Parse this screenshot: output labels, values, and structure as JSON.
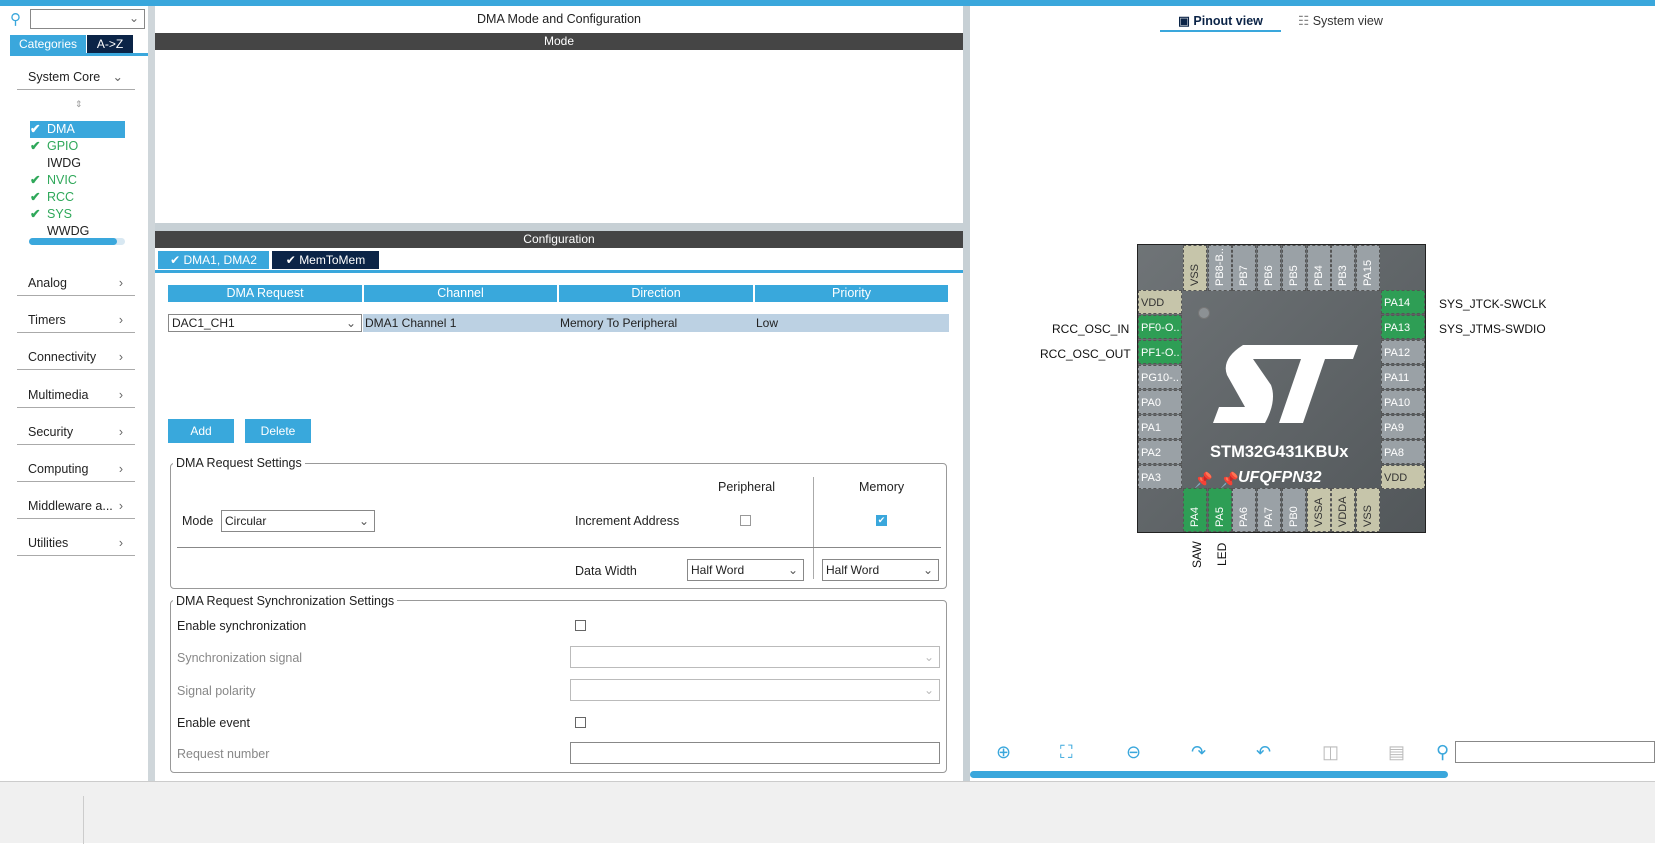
{
  "left": {
    "search_value": "",
    "tabs": [
      "Categories",
      "A->Z"
    ],
    "categories": [
      {
        "label": "System Core",
        "open": true
      },
      {
        "label": "Analog"
      },
      {
        "label": "Timers"
      },
      {
        "label": "Connectivity"
      },
      {
        "label": "Multimedia"
      },
      {
        "label": "Security"
      },
      {
        "label": "Computing"
      },
      {
        "label": "Middleware a..."
      },
      {
        "label": "Utilities"
      }
    ],
    "peripherals": [
      {
        "label": "DMA",
        "checked": true,
        "selected": true
      },
      {
        "label": "GPIO",
        "checked": true
      },
      {
        "label": "IWDG",
        "checked": false
      },
      {
        "label": "NVIC",
        "checked": true
      },
      {
        "label": "RCC",
        "checked": true
      },
      {
        "label": "SYS",
        "checked": true
      },
      {
        "label": "WWDG",
        "checked": false
      }
    ]
  },
  "middle": {
    "title": "DMA Mode and Configuration",
    "mode_header": "Mode",
    "config_header": "Configuration",
    "tabs": [
      "DMA1, DMA2",
      "MemToMem"
    ],
    "table": {
      "headers": [
        "DMA Request",
        "Channel",
        "Direction",
        "Priority"
      ],
      "rows": [
        [
          "DAC1_CH1",
          "DMA1 Channel 1",
          "Memory To Peripheral",
          "Low"
        ]
      ]
    },
    "add": "Add",
    "delete": "Delete",
    "req_settings": {
      "title": "DMA Request Settings",
      "peripheral": "Peripheral",
      "memory": "Memory",
      "mode_label": "Mode",
      "mode_value": "Circular",
      "increment_label": "Increment Address",
      "periph_increment": false,
      "mem_increment": true,
      "data_width_label": "Data Width",
      "periph_width": "Half Word",
      "mem_width": "Half Word"
    },
    "sync_settings": {
      "title": "DMA Request Synchronization Settings",
      "enable_sync": "Enable synchronization",
      "sync_signal": "Synchronization signal",
      "signal_polarity": "Signal polarity",
      "enable_event": "Enable event",
      "request_number": "Request number"
    }
  },
  "right": {
    "tabs": [
      "Pinout view",
      "System view"
    ],
    "chip": {
      "name": "STM32G431KBUx",
      "package": "UFQFPN32",
      "top": [
        [
          "VSS",
          "p"
        ],
        [
          "PB8-B..",
          "g"
        ],
        [
          "PB7",
          "g"
        ],
        [
          "PB6",
          "g"
        ],
        [
          "PB5",
          "g"
        ],
        [
          "PB4",
          "g"
        ],
        [
          "PB3",
          "g"
        ],
        [
          "PA15",
          "g"
        ]
      ],
      "left": [
        [
          "VDD",
          "p"
        ],
        [
          "PF0-O..",
          "a"
        ],
        [
          "PF1-O..",
          "a"
        ],
        [
          "PG10-..",
          "g"
        ],
        [
          "PA0",
          "g"
        ],
        [
          "PA1",
          "g"
        ],
        [
          "PA2",
          "g"
        ],
        [
          "PA3",
          "g"
        ]
      ],
      "right": [
        [
          "PA14",
          "a"
        ],
        [
          "PA13",
          "a"
        ],
        [
          "PA12",
          "g"
        ],
        [
          "PA11",
          "g"
        ],
        [
          "PA10",
          "g"
        ],
        [
          "PA9",
          "g"
        ],
        [
          "PA8",
          "g"
        ],
        [
          "VDD",
          "p"
        ]
      ],
      "bottom": [
        [
          "PA4",
          "a"
        ],
        [
          "PA5",
          "a"
        ],
        [
          "PA6",
          "g"
        ],
        [
          "PA7",
          "g"
        ],
        [
          "PB0",
          "g"
        ],
        [
          "VSSA",
          "p"
        ],
        [
          "VDDA",
          "p"
        ],
        [
          "VSS",
          "p"
        ]
      ]
    },
    "signals": {
      "rcc_in": "RCC_OSC_IN",
      "rcc_out": "RCC_OSC_OUT",
      "swclk": "SYS_JTCK-SWCLK",
      "swdio": "SYS_JTMS-SWDIO",
      "saw": "SAW",
      "led": "LED"
    }
  }
}
